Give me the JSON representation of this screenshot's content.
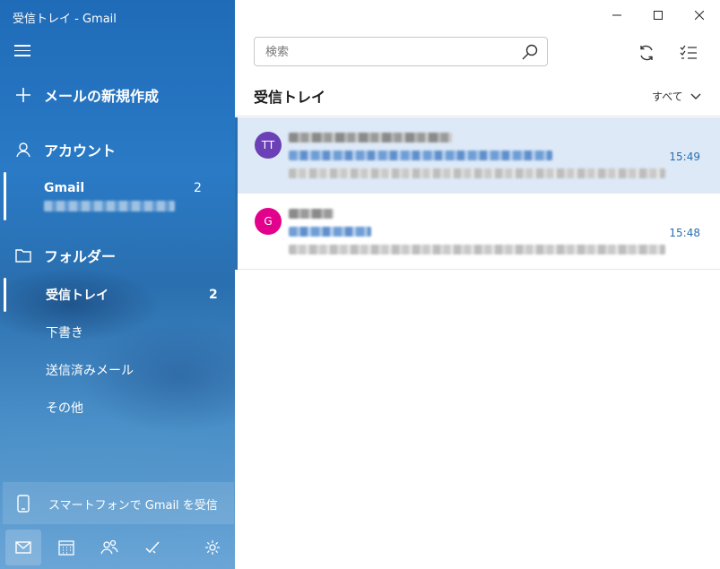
{
  "window": {
    "title": "受信トレイ - Gmail"
  },
  "sidebar": {
    "new_mail_label": "メールの新規作成",
    "account_header": "アカウント",
    "account": {
      "name": "Gmail",
      "count": "2"
    },
    "folders_header": "フォルダー",
    "folders": [
      {
        "label": "受信トレイ",
        "count": "2"
      },
      {
        "label": "下書き",
        "count": ""
      },
      {
        "label": "送信済みメール",
        "count": ""
      },
      {
        "label": "その他",
        "count": ""
      }
    ],
    "promo_label": "スマートフォンで Gmail を受信"
  },
  "search": {
    "placeholder": "検索"
  },
  "list": {
    "title": "受信トレイ",
    "filter_label": "すべて",
    "messages": [
      {
        "avatar_initials": "TT",
        "avatar_color": "#6b3fb5",
        "time": "15:49",
        "selected": true
      },
      {
        "avatar_initials": "G",
        "avatar_color": "#e3008c",
        "time": "15:48",
        "selected": false
      }
    ]
  },
  "colors": {
    "accent": "#2a6faf",
    "selected_row": "#dde9f6"
  }
}
